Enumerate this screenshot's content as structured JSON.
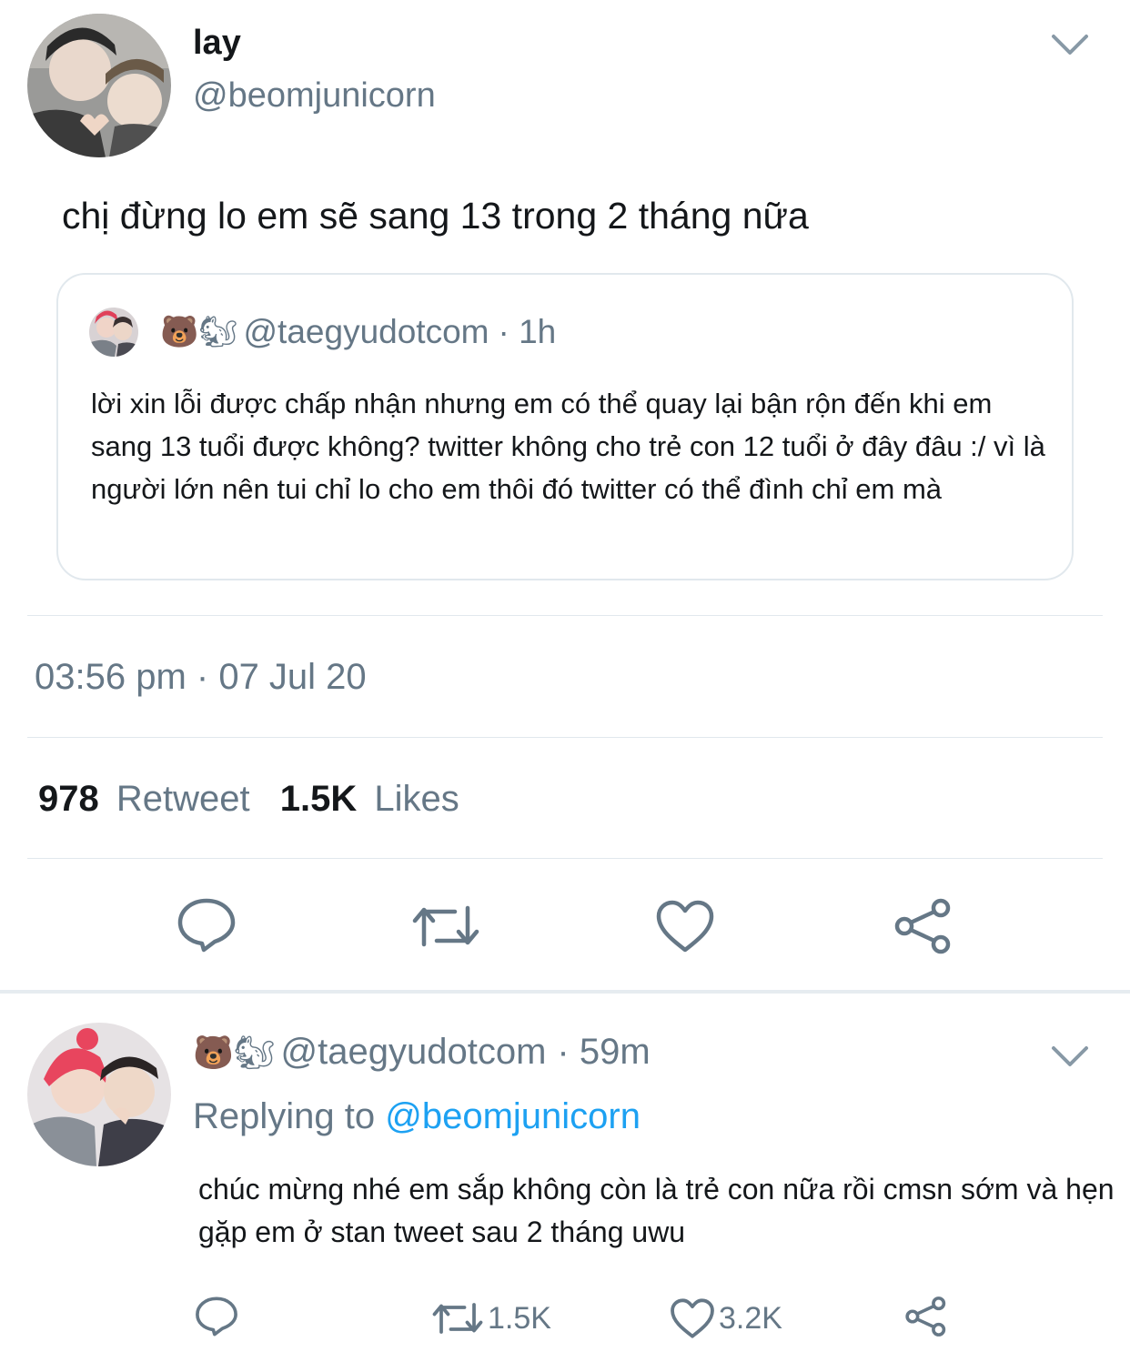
{
  "main_tweet": {
    "name": "lay",
    "handle": "@beomjunicorn",
    "text": "chị đừng lo em sẽ sang 13 trong  2 tháng nữa",
    "timestamp": "03:56 pm · 07 Jul 20",
    "stats": {
      "retweets_count": "978",
      "retweets_label": "Retweet",
      "likes_count": "1.5K",
      "likes_label": "Likes"
    }
  },
  "quoted_tweet": {
    "emoji": "🐻🐿",
    "handle": "@taegyudotcom",
    "time": "· 1h",
    "text": "lời xin lỗi được chấp nhận nhưng em có thể quay lại bận rộn đến khi em sang 13 tuổi được không? twitter không cho trẻ con 12 tuổi ở đây đâu :/ vì là người lớn nên tui chỉ lo cho em thôi đó twitter có thể đình chỉ em mà"
  },
  "reply_tweet": {
    "emoji": "🐻🐿",
    "handle": "@taegyudotcom",
    "time": "· 59m",
    "replying_prefix": "Replying to",
    "replying_handle": "@beomjunicorn",
    "text": "chúc mừng nhé em sắp không còn là trẻ con nữa rồi cmsn sớm và hẹn gặp em ở stan tweet sau 2 tháng uwu",
    "retweets": "1.5K",
    "likes": "3.2K"
  },
  "colors": {
    "primary_text": "#14171a",
    "secondary_text": "#657786",
    "link": "#1da1f2",
    "border": "#e1e8ed"
  },
  "icons": [
    "chevron-down-icon",
    "reply-icon",
    "retweet-icon",
    "like-icon",
    "share-icon"
  ]
}
